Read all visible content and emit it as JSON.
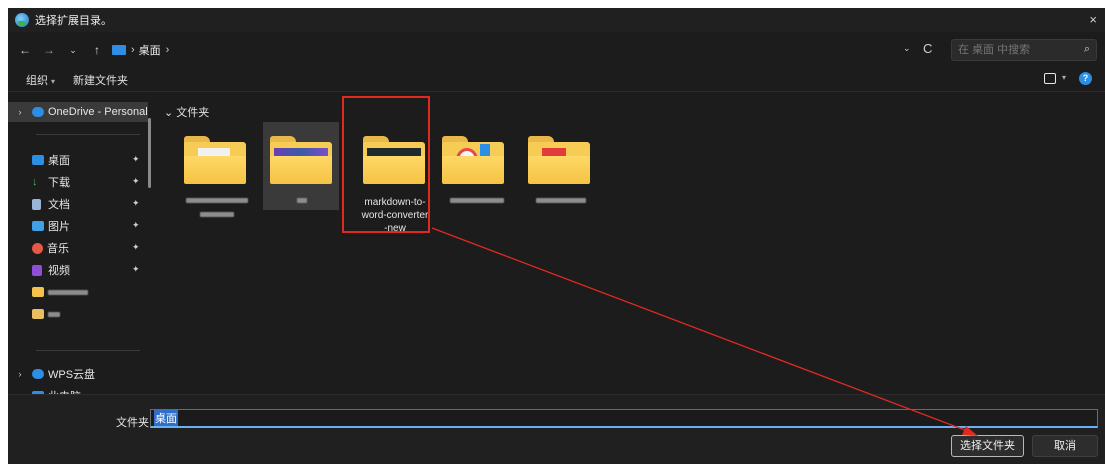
{
  "window": {
    "title": "选择扩展目录。",
    "close_glyph": "×"
  },
  "nav": {
    "back": "←",
    "forward": "→",
    "recent": "⌄",
    "up": "↑",
    "breadcrumb_sep": "›",
    "breadcrumb": [
      "桌面"
    ],
    "refresh": "C"
  },
  "search": {
    "placeholder": "在 桌面 中搜索",
    "icon": "search-icon"
  },
  "command_bar": {
    "organize": "组织",
    "new_folder": "新建文件夹",
    "help": "?"
  },
  "sidebar": {
    "items": [
      {
        "label": "OneDrive - Personal",
        "icon": "cloud-icon",
        "color": "#2b8fe6",
        "expand": "›",
        "selected": true
      },
      {
        "label": "桌面",
        "icon": "desktop-icon",
        "color": "#2b8fe6",
        "pinned": true
      },
      {
        "label": "下载",
        "icon": "download-icon",
        "color": "#45b36b",
        "pinned": true
      },
      {
        "label": "文档",
        "icon": "document-icon",
        "color": "#9ab6d6",
        "pinned": true
      },
      {
        "label": "图片",
        "icon": "pictures-icon",
        "color": "#3fa0e6",
        "pinned": true
      },
      {
        "label": "音乐",
        "icon": "music-icon",
        "color": "#e6584a",
        "pinned": true
      },
      {
        "label": "视频",
        "icon": "video-icon",
        "color": "#8e4fd6",
        "pinned": true
      },
      {
        "label": "WPS云盘",
        "icon": "wps-cloud-icon",
        "color": "#2b8fe6",
        "expand": "›"
      },
      {
        "label": "此电脑",
        "icon": "computer-icon",
        "color": "#2b8fe6",
        "expand": "⌄"
      }
    ],
    "pin_glyph": "📌"
  },
  "content": {
    "group_header": "文件夹",
    "group_chevron": "⌄",
    "items": [
      {
        "name": "",
        "icon": "folder-icon"
      },
      {
        "name": "",
        "icon": "folder-icon"
      },
      {
        "name": "markdown-to-word-converter-new",
        "label_lines": [
          "markdown-to-",
          "word-converter",
          "-new"
        ],
        "icon": "folder-icon",
        "highlighted": true
      },
      {
        "name": "",
        "icon": "folder-icon"
      },
      {
        "name": "",
        "icon": "folder-icon"
      }
    ]
  },
  "footer": {
    "folder_label": "文件夹:",
    "folder_value": "桌面",
    "select_button": "选择文件夹",
    "cancel_button": "取消"
  },
  "colors": {
    "annotation_red": "#e12a1f",
    "folder_yellow": "#f6cc55",
    "accent_blue": "#2b8fe6"
  }
}
